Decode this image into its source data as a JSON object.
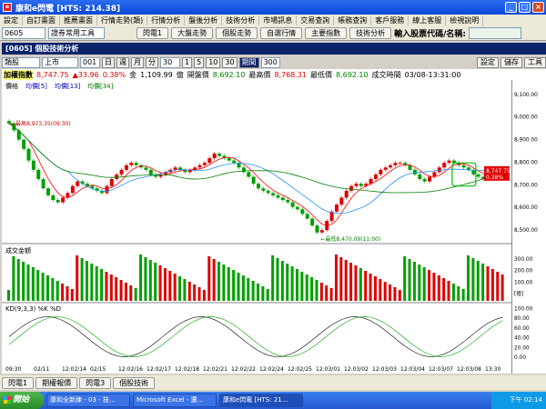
{
  "window": {
    "title": "康和e閃電 [HTS: 214.38]",
    "icon": "app-icon",
    "controls": [
      "_",
      "□",
      "×"
    ]
  },
  "menu": [
    "設定",
    "自訂畫面",
    "推薦畫面",
    "行情走勢(類)",
    "行情分析",
    "盤後分析",
    "技術分析",
    "市場訊息",
    "交易查詢",
    "帳務查詢",
    "客戶服務",
    "線上客服",
    "檢視說明"
  ],
  "toolbar": {
    "code": "0605",
    "group": "證券常用工具",
    "b1": "閃電1",
    "b2": "大盤走勢",
    "b3": "個股走勢",
    "b4": "自選行情",
    "b5": "主要指數",
    "b6": "技術分析",
    "inputlabel": "輸入股票代碼/名稱:",
    "input": ""
  },
  "subtitle": "[0605] 個股技術分析",
  "sub": {
    "type": "類股",
    "market": "上市",
    "num": "001",
    "periods": [
      "日",
      "週",
      "月",
      "分"
    ],
    "min": "30",
    "ranges": [
      "1",
      "5",
      "10",
      "30"
    ],
    "selrange": "期間",
    "count": "300",
    "right": [
      "設定",
      "儲存",
      "工具"
    ]
  },
  "info": {
    "name": "加權指數",
    "price": "8,747.75",
    "chg": "▲33.96",
    "pct": "0.38%",
    "vollabel": "金",
    "vol": "1,109.99",
    "unit": "億",
    "openlabel": "開盤價",
    "open": "8,692.10",
    "highlabel": "最高價",
    "high": "8,768.31",
    "lowlabel": "最低價",
    "low": "8,692.10",
    "timelabel": "成交時間",
    "time": "03/08-13:31:00"
  },
  "legend": {
    "price": "價格",
    "ma1": "均價[5]",
    "ma2": "均價[13]",
    "ma3": "均價[34]"
  },
  "volume_label": "成交金額",
  "kd_label": "KD(9,3,3) %K %D",
  "annotations": {
    "hi": "最高8,973.35(09:30)",
    "lo": "最低8,470.09(11:00)",
    "last": "8,747.75",
    "lastpct": "0.38%"
  },
  "dates": [
    "09:30",
    "02/11",
    "12:02/14",
    "02/15",
    "12:02/16",
    "12:02/17",
    "12:02/18",
    "12:02/21",
    "12:02/22",
    "12:02/24",
    "12:02/25",
    "12:03/01",
    "12:03/02",
    "12:03/03",
    "12:03/04",
    "12:03/07",
    "12:03/08",
    "13:30"
  ],
  "chart_data": {
    "type": "candlestick",
    "title": "加權指數",
    "yrange": [
      8450,
      9100
    ],
    "yticks": [
      "9,100.00",
      "9,000.00",
      "8,900.00",
      "8,800.00",
      "8,700.00",
      "8,600.00",
      "8,500.00"
    ],
    "volticks": [
      "300.00",
      "200.00",
      "100.00",
      "[億]"
    ],
    "kdticks": [
      "100.00",
      "80.00",
      "60.00",
      "40.00",
      "20.00",
      "0.00"
    ],
    "close": [
      8960,
      8930,
      8890,
      8850,
      8800,
      8760,
      8720,
      8680,
      8650,
      8630,
      8620,
      8640,
      8660,
      8690,
      8710,
      8700,
      8690,
      8680,
      8670,
      8660,
      8690,
      8720,
      8740,
      8760,
      8780,
      8790,
      8780,
      8770,
      8760,
      8740,
      8730,
      8740,
      8750,
      8760,
      8770,
      8760,
      8750,
      8760,
      8770,
      8780,
      8790,
      8810,
      8830,
      8820,
      8810,
      8800,
      8790,
      8770,
      8750,
      8730,
      8700,
      8680,
      8670,
      8660,
      8650,
      8640,
      8630,
      8620,
      8600,
      8590,
      8570,
      8550,
      8520,
      8490,
      8500,
      8540,
      8580,
      8610,
      8640,
      8670,
      8690,
      8700,
      8690,
      8700,
      8720,
      8740,
      8760,
      8770,
      8780,
      8790,
      8790,
      8780,
      8760,
      8740,
      8720,
      8710,
      8730,
      8750,
      8770,
      8790,
      8800,
      8790,
      8780,
      8770,
      8760,
      8740,
      8730,
      8720,
      8730,
      8740,
      8745,
      8747
    ]
  },
  "status": [
    "閃電1",
    "期權報價",
    "閃電3",
    "個股技術"
  ],
  "taskbar": {
    "start": "開始",
    "tasks": [
      "康和全新練 - 03 - 技...",
      "Microsoft Excel - 還...",
      "康和e閃電 [HTS: 21..."
    ],
    "clock": "下午 02:14"
  }
}
